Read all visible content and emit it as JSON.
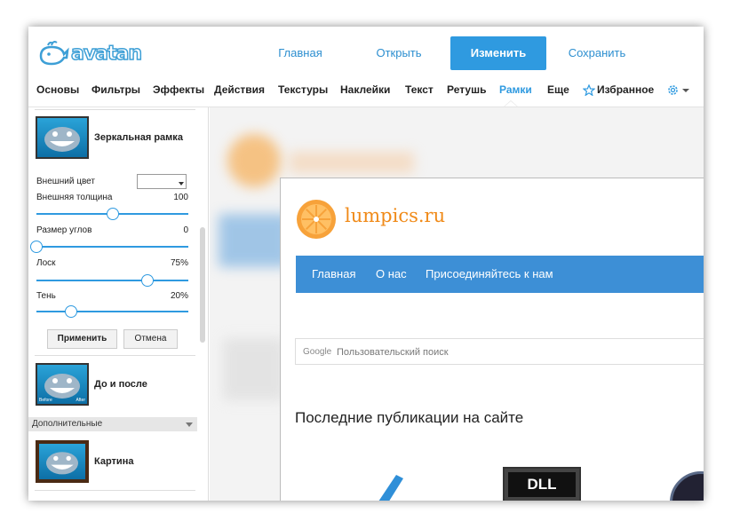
{
  "app": {
    "logo": "avatan"
  },
  "topnav": {
    "home": "Главная",
    "open": "Открыть",
    "edit": "Изменить",
    "save": "Сохранить"
  },
  "menu": {
    "items": [
      "Основы",
      "Фильтры",
      "Эффекты",
      "Действия",
      "Текстуры",
      "Наклейки",
      "Текст",
      "Ретушь",
      "Рамки",
      "Еще"
    ],
    "active": "Рамки",
    "favorites": "Избранное"
  },
  "panel": {
    "effect1": "Зеркальная рамка",
    "outer_color": "Внешний цвет",
    "outer_thickness": {
      "label": "Внешняя толщина",
      "value": "100",
      "level": 0.5
    },
    "corner_size": {
      "label": "Размер углов",
      "value": "0",
      "level": 0.0
    },
    "gloss": {
      "label": "Лоск",
      "value": "75%",
      "level": 0.73
    },
    "shadow": {
      "label": "Тень",
      "value": "20%",
      "level": 0.23
    },
    "apply": "Применить",
    "cancel": "Отмена",
    "effect2": "До и после",
    "before": "Before",
    "after": "After",
    "category": "Дополнительные",
    "effect3": "Картина"
  },
  "image": {
    "site_name": "lumpics.ru",
    "nav": [
      "Главная",
      "О нас",
      "Присоединяйтесь к нам"
    ],
    "search_google": "Google",
    "search_placeholder": "Пользовательский поиск",
    "heading": "Последние публикации на сайте",
    "dll_label": "DLL"
  },
  "colors": {
    "accent": "#2f9ae0",
    "orange": "#f08a18",
    "nav_blue": "#3d8fd6"
  }
}
